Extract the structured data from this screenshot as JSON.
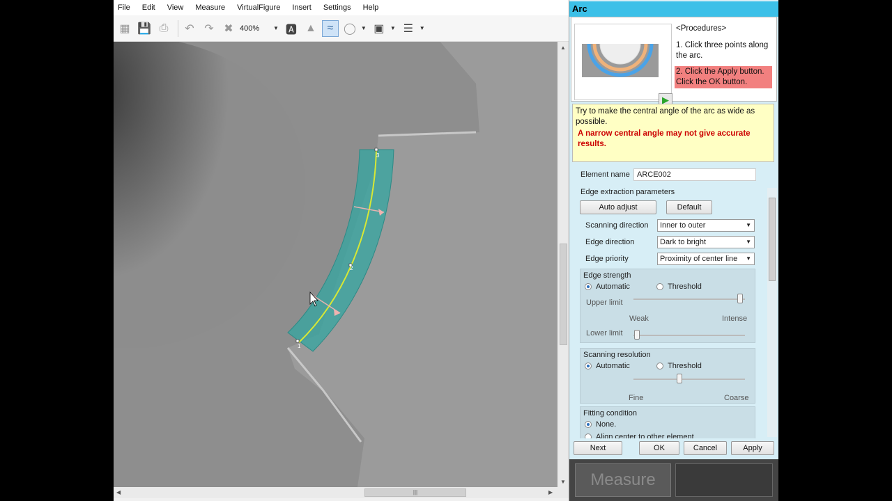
{
  "menu": [
    "File",
    "Edit",
    "View",
    "Measure",
    "VirtualFigure",
    "Insert",
    "Settings",
    "Help"
  ],
  "toolbar": {
    "zoom": "400%"
  },
  "panel": {
    "title": "Arc",
    "procedures_heading": "<Procedures>",
    "step1": "1. Click three points along the arc.",
    "step2a": "2. Click the Apply button.",
    "step2b": "Click the OK button.",
    "tip": "Try to make the central angle of the arc as wide as possible.",
    "warning": "A narrow central angle may not give accurate results."
  },
  "settings": {
    "element_name_label": "Element name",
    "element_name_value": "ARCE002",
    "edge_params_label": "Edge extraction parameters",
    "auto_adjust": "Auto adjust",
    "default": "Default",
    "scan_dir_label": "Scanning direction",
    "scan_dir_value": "Inner to outer",
    "edge_dir_label": "Edge direction",
    "edge_dir_value": "Dark to bright",
    "edge_priority_label": "Edge priority",
    "edge_priority_value": "Proximity of center line",
    "edge_strength_label": "Edge strength",
    "automatic": "Automatic",
    "threshold": "Threshold",
    "upper_limit": "Upper limit",
    "weak": "Weak",
    "intense": "Intense",
    "lower_limit": "Lower limit",
    "scan_res_label": "Scanning resolution",
    "fine": "Fine",
    "coarse": "Coarse",
    "fitting_label": "Fitting condition",
    "none": "None.",
    "align_center": "Align center to other element"
  },
  "buttons": {
    "next": "Next",
    "ok": "OK",
    "cancel": "Cancel",
    "apply": "Apply",
    "measure": "Measure"
  },
  "hscroll_grip": "|||",
  "point_labels": [
    "1",
    "2",
    "3"
  ],
  "colors": {
    "title_bar": "#3cc0e8",
    "arc_band": "#3aa5a0",
    "center_line": "#d8e834",
    "step_highlight": "#f2807f",
    "warning_red": "#cc0000"
  }
}
